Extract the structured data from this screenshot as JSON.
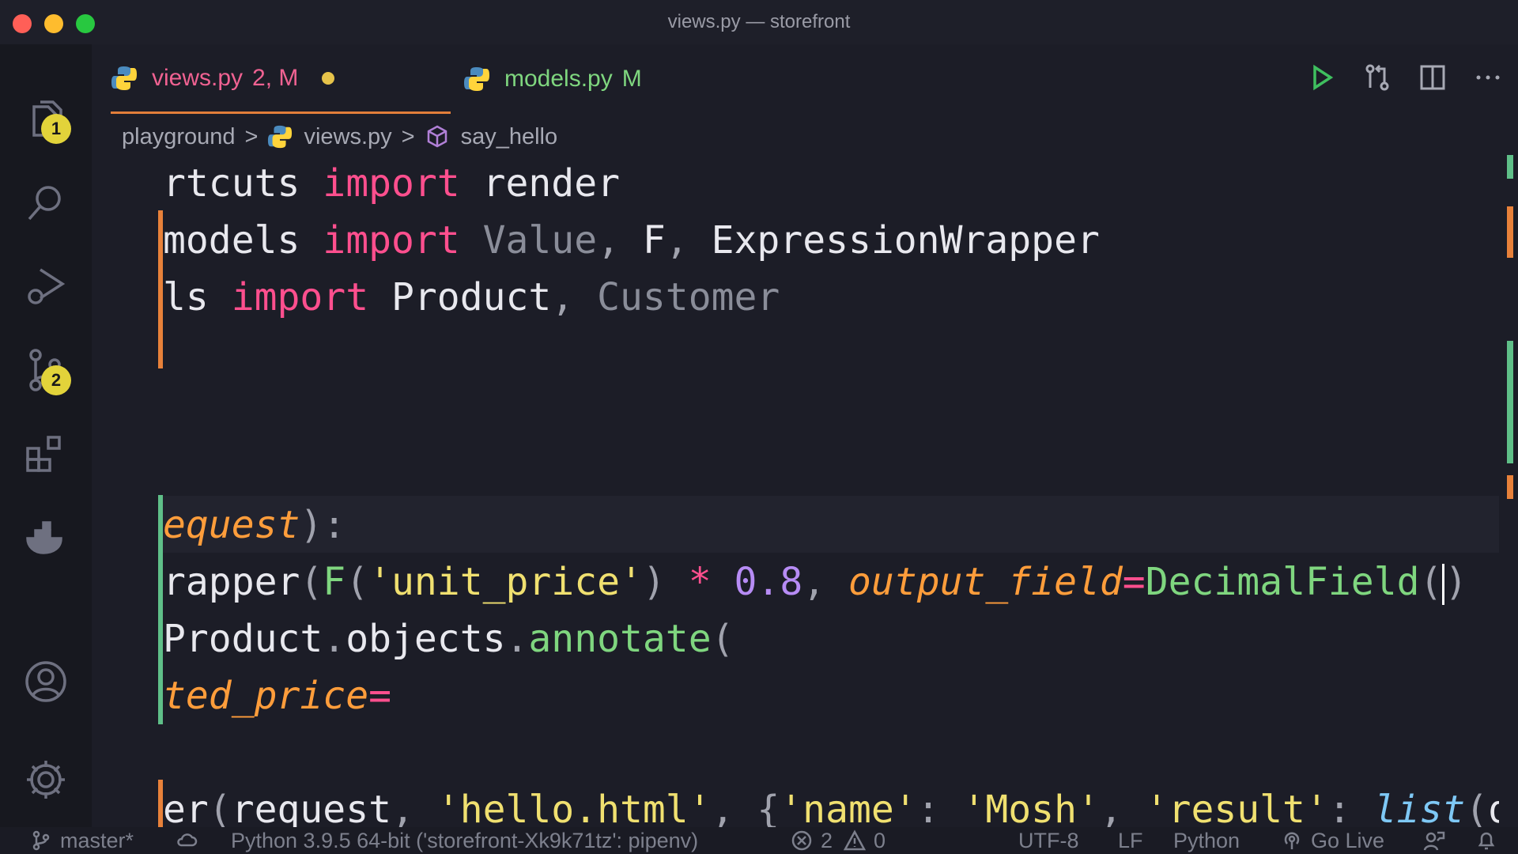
{
  "window": {
    "title": "views.py — storefront"
  },
  "activity_bar": {
    "explorer_badge": "1",
    "source_control_badge": "2"
  },
  "tabs": [
    {
      "name": "views.py",
      "status": "2, M",
      "dirty": true
    },
    {
      "name": "models.py",
      "status": "M"
    }
  ],
  "breadcrumb": {
    "folder": "playground",
    "file": "views.py",
    "symbol": "say_hello"
  },
  "code": {
    "line1": [
      "rtcuts",
      " ",
      "import",
      " ",
      "render"
    ],
    "line2": [
      "models",
      " ",
      "import",
      " ",
      "Value",
      ", ",
      "F",
      ", ",
      "ExpressionWrapper"
    ],
    "line3": [
      "ls",
      " ",
      "import",
      " ",
      "Product",
      ", ",
      "Customer"
    ],
    "line4": [
      "equest",
      ")",
      ":"
    ],
    "line5": [
      "rapper",
      "(",
      "F",
      "(",
      "'unit_price'",
      ")",
      " ",
      "*",
      " ",
      "0.8",
      ", ",
      "output_field",
      "=",
      "DecimalField",
      "(",
      ")"
    ],
    "line6": [
      "Product",
      ".",
      "objects",
      ".",
      "annotate",
      "("
    ],
    "line7": [
      "ted_price",
      "="
    ],
    "line8": [
      "er",
      "(",
      "request",
      ", ",
      "'hello.html'",
      ", ",
      "{",
      "'name'",
      ": ",
      "'Mosh'",
      ", ",
      "'result'",
      ": ",
      "list",
      "(",
      "q"
    ]
  },
  "status_bar": {
    "branch": "master*",
    "interpreter": "Python 3.9.5 64-bit ('storefront-Xk9k71tz': pipenv)",
    "errors": "2",
    "warnings": "0",
    "encoding": "UTF-8",
    "eol": "LF",
    "language": "Python",
    "go_live": "Go Live"
  },
  "colors": {
    "keyword": "#ff4f8e",
    "string": "#f0e070",
    "number": "#b78cf5",
    "function": "#7fd67f",
    "parameter": "#ff9d3b",
    "modified_gutter": "#e8813a",
    "added_gutter": "#5fbf88"
  }
}
